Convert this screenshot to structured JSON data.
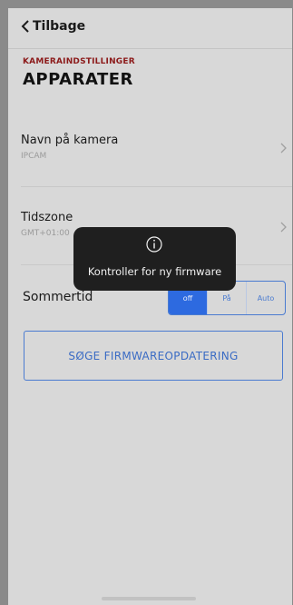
{
  "nav": {
    "back_label": "Tilbage"
  },
  "header": {
    "section_label": "KAMERAINDSTILLINGER",
    "title": "APPARATER"
  },
  "camera_name": {
    "label": "Navn på kamera",
    "value": "IPCAM"
  },
  "timezone": {
    "label": "Tidszone",
    "value": "GMT+01:00"
  },
  "dst": {
    "label": "Sommertid",
    "options": [
      "off",
      "På",
      "Auto"
    ],
    "selected": "off"
  },
  "firmware_button": {
    "label": "SØGE FIRMWAREOPDATERING"
  },
  "toast": {
    "message": "Kontroller for ny firmware",
    "icon": "info-icon"
  },
  "colors": {
    "accent_blue": "#2d6ae0",
    "section_red": "#8c1a1a",
    "toast_bg": "#1f1f1f"
  }
}
